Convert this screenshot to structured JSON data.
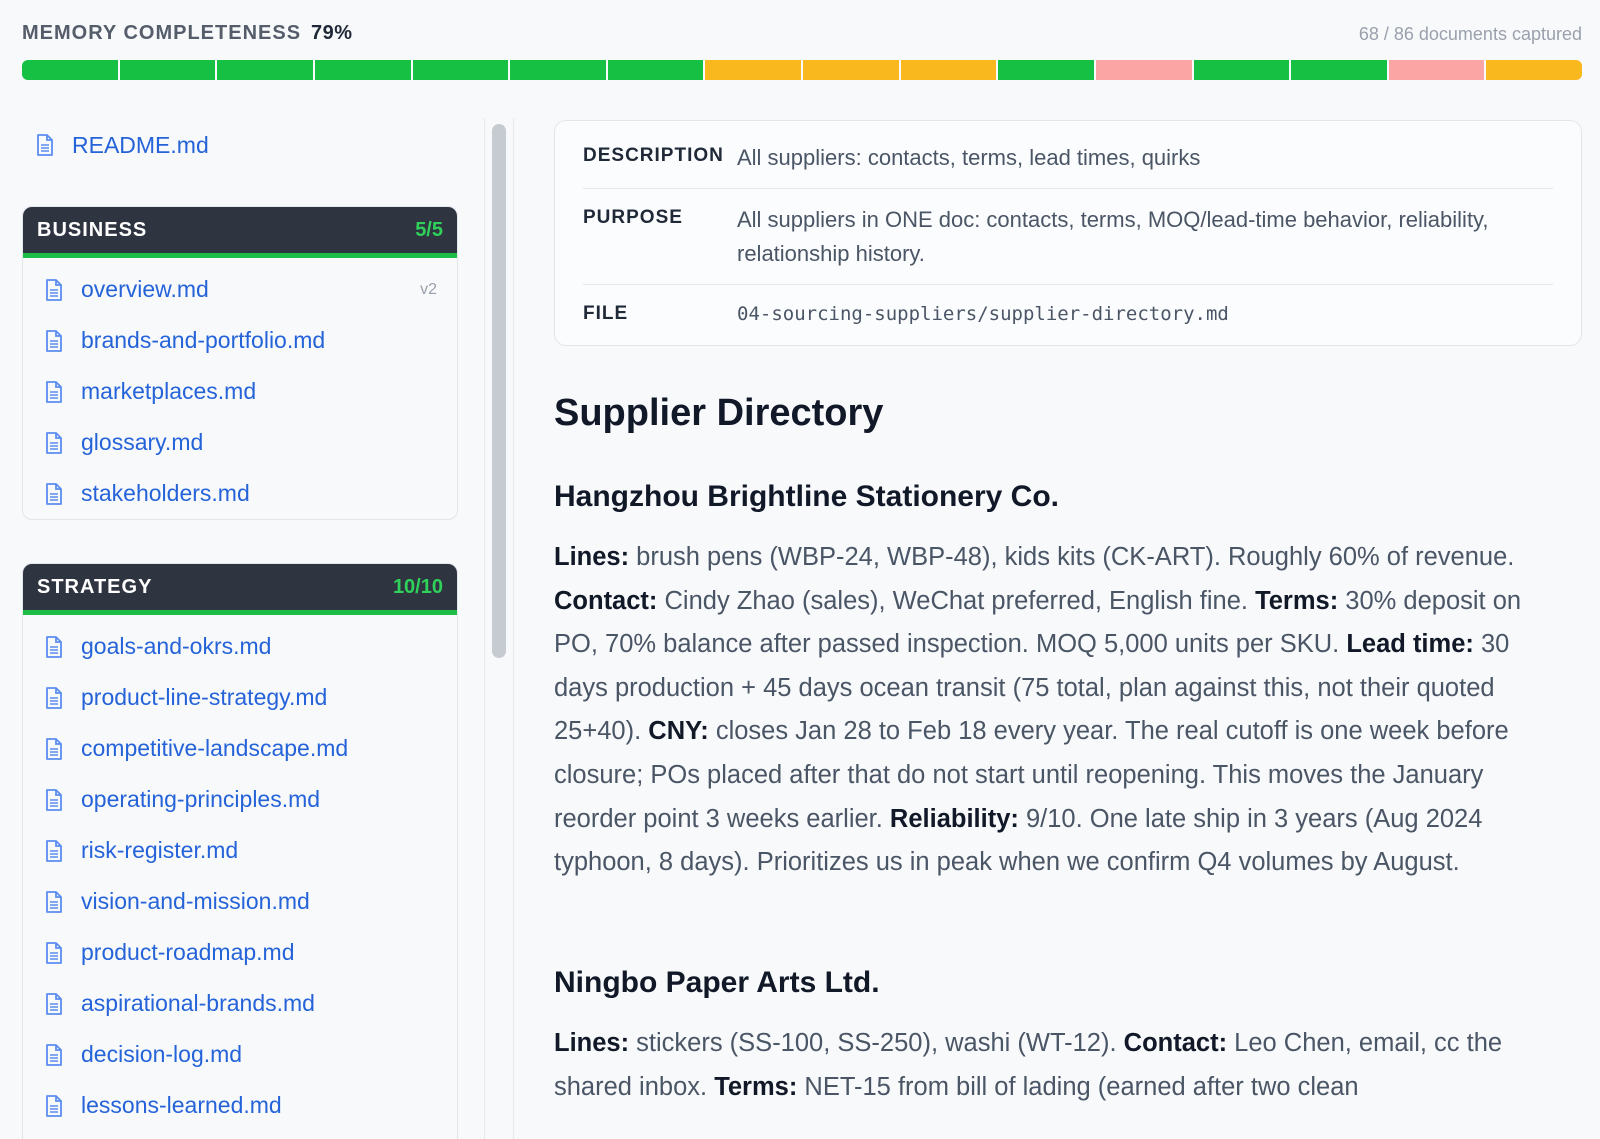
{
  "completeness": {
    "label": "MEMORY COMPLETENESS",
    "percent": "79%",
    "captured": "68 / 86 documents captured",
    "segments": [
      {
        "status": "complete"
      },
      {
        "status": "complete"
      },
      {
        "status": "complete"
      },
      {
        "status": "complete"
      },
      {
        "status": "complete"
      },
      {
        "status": "complete"
      },
      {
        "status": "complete"
      },
      {
        "status": "partial"
      },
      {
        "status": "partial"
      },
      {
        "status": "partial"
      },
      {
        "status": "complete"
      },
      {
        "status": "missing"
      },
      {
        "status": "complete"
      },
      {
        "status": "complete"
      },
      {
        "status": "missing"
      },
      {
        "status": "partial"
      }
    ],
    "colors": {
      "complete": "#16c043",
      "partial": "#f8b81e",
      "missing": "#fca5a5"
    }
  },
  "sidebar": {
    "readme": {
      "label": "README.md",
      "icon": "file-icon"
    },
    "groups": [
      {
        "title": "BUSINESS",
        "count": "5/5",
        "items": [
          {
            "label": "overview.md",
            "version": "v2"
          },
          {
            "label": "brands-and-portfolio.md"
          },
          {
            "label": "marketplaces.md"
          },
          {
            "label": "glossary.md"
          },
          {
            "label": "stakeholders.md"
          }
        ]
      },
      {
        "title": "STRATEGY",
        "count": "10/10",
        "items": [
          {
            "label": "goals-and-okrs.md"
          },
          {
            "label": "product-line-strategy.md"
          },
          {
            "label": "competitive-landscape.md"
          },
          {
            "label": "operating-principles.md"
          },
          {
            "label": "risk-register.md"
          },
          {
            "label": "vision-and-mission.md"
          },
          {
            "label": "product-roadmap.md"
          },
          {
            "label": "aspirational-brands.md"
          },
          {
            "label": "decision-log.md"
          },
          {
            "label": "lessons-learned.md"
          }
        ]
      }
    ]
  },
  "meta": {
    "description": {
      "key": "DESCRIPTION",
      "value": "All suppliers: contacts, terms, lead times, quirks"
    },
    "purpose": {
      "key": "PURPOSE",
      "value": "All suppliers in ONE doc: contacts, terms, MOQ/lead-time behavior, reliability, relationship history."
    },
    "file": {
      "key": "FILE",
      "value": "04-sourcing-suppliers/supplier-directory.md"
    }
  },
  "document": {
    "title": "Supplier Directory",
    "sections": [
      {
        "title": "Hangzhou Brightline Stationery Co.",
        "paragraph": [
          {
            "b": "Lines:",
            "t": " brush pens (WBP-24, WBP-48), kids kits (CK-ART). Roughly 60% of revenue. "
          },
          {
            "b": "Contact:",
            "t": " Cindy Zhao (sales), WeChat preferred, English fine. "
          },
          {
            "b": "Terms:",
            "t": " 30% deposit on PO, 70% balance after passed inspection. MOQ 5,000 units per SKU. "
          },
          {
            "b": "Lead time:",
            "t": " 30 days production + 45 days ocean transit (75 total, plan against this, not their quoted 25+40). "
          },
          {
            "b": "CNY:",
            "t": " closes Jan 28 to Feb 18 every year. The real cutoff is one week before closure; POs placed after that do not start until reopening. This moves the January reorder point 3 weeks earlier. "
          },
          {
            "b": "Reliability:",
            "t": " 9/10. One late ship in 3 years (Aug 2024 typhoon, 8 days). Prioritizes us in peak when we confirm Q4 volumes by August."
          }
        ]
      },
      {
        "title": "Ningbo Paper Arts Ltd.",
        "paragraph": [
          {
            "b": "Lines:",
            "t": " stickers (SS-100, SS-250), washi (WT-12). "
          },
          {
            "b": "Contact:",
            "t": " Leo Chen, email, cc the shared inbox. "
          },
          {
            "b": "Terms:",
            "t": " NET-15 from bill of lading (earned after two clean"
          }
        ]
      }
    ]
  }
}
